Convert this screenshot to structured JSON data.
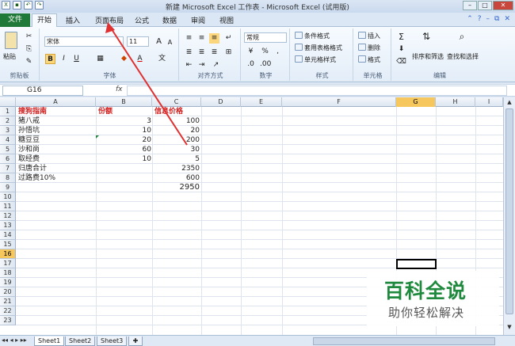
{
  "titlebar": {
    "title": "新建 Microsoft Excel 工作表 - Microsoft Excel (试用版)"
  },
  "tabs": {
    "file": "文件",
    "home": "开始",
    "insert": "插入",
    "page_layout": "页面布局",
    "formulas": "公式",
    "data": "数据",
    "review": "审阅",
    "view": "视图"
  },
  "ribbon": {
    "clipboard": {
      "paste": "粘贴",
      "label": "剪贴板"
    },
    "font": {
      "name": "宋体",
      "size": "11",
      "grow": "A",
      "shrink": "A",
      "bold": "B",
      "italic": "I",
      "underline": "U",
      "label": "字体"
    },
    "alignment": {
      "label": "对齐方式"
    },
    "number": {
      "format": "常规",
      "percent": "%",
      "comma": ",",
      "label": "数字"
    },
    "styles": {
      "conditional": "条件格式",
      "table": "套用表格格式",
      "cell": "单元格样式",
      "label": "样式"
    },
    "cells": {
      "insert": "插入",
      "delete": "删除",
      "format": "格式",
      "label": "单元格"
    },
    "editing": {
      "sum": "Σ",
      "sort": "排序和筛选",
      "find": "查找和选择",
      "label": "编辑"
    }
  },
  "formula": {
    "namebox": "G16",
    "fx": "fx",
    "value": ""
  },
  "columns": [
    "A",
    "B",
    "C",
    "D",
    "E",
    "F",
    "G",
    "H",
    "I"
  ],
  "selected_column": "G",
  "selected_row": "16",
  "rows": [
    "1",
    "2",
    "3",
    "4",
    "5",
    "6",
    "7",
    "8",
    "9",
    "10",
    "11",
    "12",
    "13",
    "14",
    "15",
    "16",
    "17",
    "18",
    "19",
    "20",
    "21",
    "22",
    "23"
  ],
  "cells": {
    "r1": {
      "a": "搜狗指南",
      "b": "份额",
      "c": "信息价格"
    },
    "r2": {
      "a": "猪八戒",
      "b": "3",
      "c": "100"
    },
    "r3": {
      "a": "孙悟坑",
      "b": "10",
      "c": "20"
    },
    "r4": {
      "a": "糖豆豆",
      "b": "20",
      "c": "200"
    },
    "r5": {
      "a": "沙和尚",
      "b": "60",
      "c": "30"
    },
    "r6": {
      "a": "取经费",
      "b": "10",
      "c": "5"
    },
    "r7": {
      "a": "归唐合计",
      "c": "2350"
    },
    "r8": {
      "a": "过路费10%",
      "c": "600"
    },
    "r9": {
      "c": "2950"
    }
  },
  "sheets": [
    "Sheet1",
    "Sheet2",
    "Sheet3"
  ],
  "watermark": {
    "main": "百科全说",
    "sub": "助你轻松解决"
  },
  "colors": {
    "header_red": "#d21f1f",
    "file_tab": "#1f7a3a",
    "watermark_green": "#1f8a3e",
    "arrow": "#e03030"
  }
}
